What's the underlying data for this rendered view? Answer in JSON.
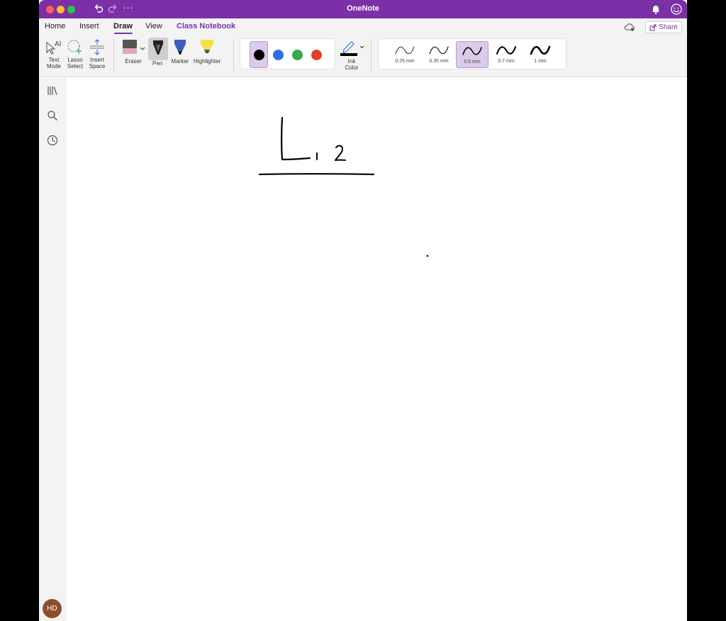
{
  "window": {
    "title": "OneNote"
  },
  "tabs": [
    {
      "label": "Home"
    },
    {
      "label": "Insert"
    },
    {
      "label": "Draw"
    },
    {
      "label": "View"
    },
    {
      "label": "Class Notebook"
    }
  ],
  "share": {
    "label": "Share"
  },
  "ribbon": {
    "text_mode": {
      "line1": "Text",
      "line2": "Mode"
    },
    "lasso_select": {
      "line1": "Lasso",
      "line2": "Select"
    },
    "insert_space": {
      "line1": "Insert",
      "line2": "Space"
    },
    "eraser": "Eraser",
    "pen": "Pen",
    "marker": "Marker",
    "highlighter": "Highlighter",
    "ink_color": {
      "line1": "Ink",
      "line2": "Color"
    },
    "colors": [
      "#000000",
      "#2f6ee8",
      "#3aa84a",
      "#e0402c"
    ],
    "selected_color": "#000000",
    "thicknesses": [
      {
        "label": "0.25 mm"
      },
      {
        "label": "0.35 mm"
      },
      {
        "label": "0.5 mm",
        "selected": true
      },
      {
        "label": "0.7 mm"
      },
      {
        "label": "1 mm"
      }
    ]
  },
  "user": {
    "initials": "HD"
  },
  "accent_color": "#7b30a8"
}
